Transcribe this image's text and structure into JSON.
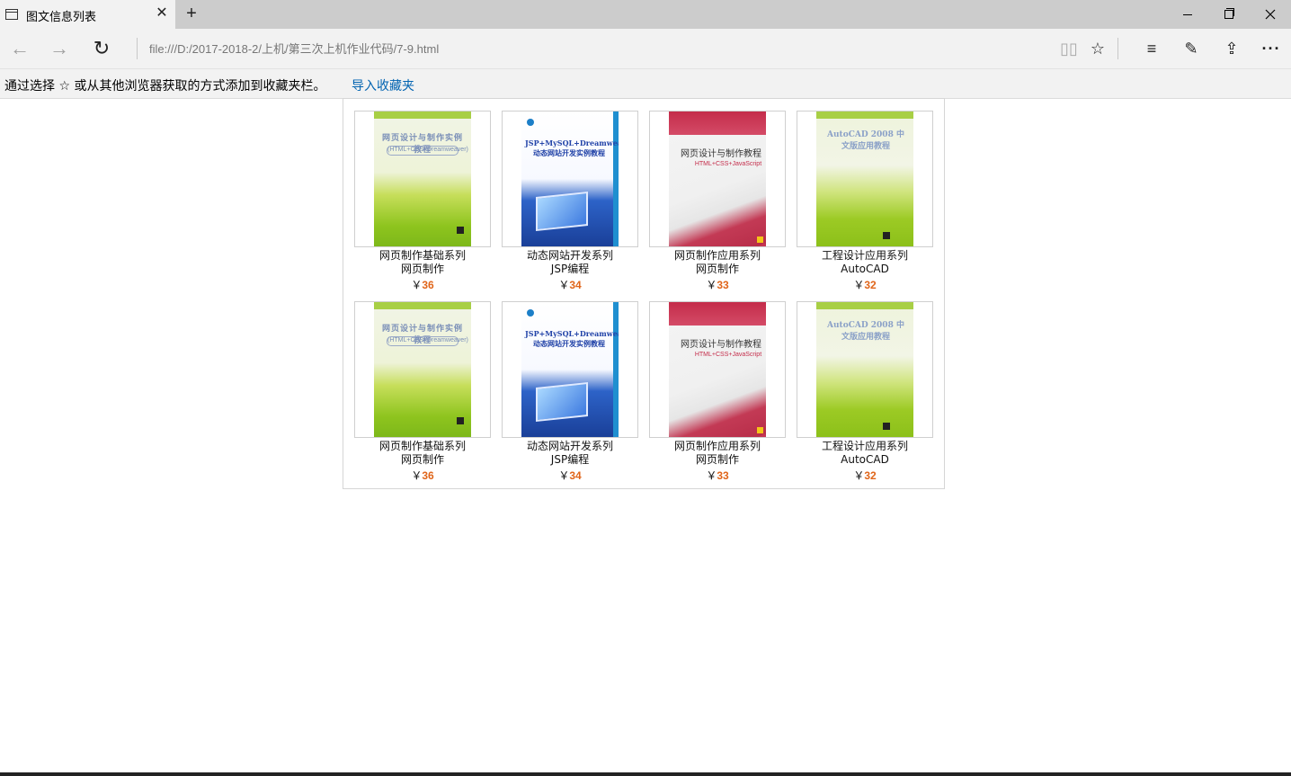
{
  "window": {
    "tab_title": "图文信息列表",
    "tab_close": "✕",
    "new_tab": "+"
  },
  "toolbar": {
    "back_icon": "←",
    "forward_icon": "→",
    "refresh_icon": "↻",
    "address": "file:///D:/2017-2018-2/上机/第三次上机作业代码/7-9.html",
    "reading_icon": "▯▯",
    "favorite_icon": "☆",
    "hub_icon": "≡",
    "note_icon": "✎",
    "share_icon": "⇪",
    "more_icon": "···"
  },
  "favorites_bar": {
    "message": "通过选择 ☆ 或从其他浏览器获取的方式添加到收藏夹栏。",
    "import_link": "导入收藏夹"
  },
  "products": [
    {
      "series": "网页制作基础系列",
      "name": "网页制作",
      "currency": "￥",
      "price": "36",
      "cover_title": "网页设计与制作实例教程",
      "cover_subtitle": "(HTML+CSS+Dreamweaver)",
      "cover_style": "green"
    },
    {
      "series": "动态网站开发系列",
      "name": "JSP编程",
      "currency": "￥",
      "price": "34",
      "cover_title": "JSP+MySQL+Dreamweaver动态网站开发实例教程",
      "cover_subtitle": "",
      "cover_style": "blue"
    },
    {
      "series": "网页制作应用系列",
      "name": "网页制作",
      "currency": "￥",
      "price": "33",
      "cover_title": "网页设计与制作教程",
      "cover_subtitle": "HTML+CSS+JavaScript",
      "cover_style": "red"
    },
    {
      "series": "工程设计应用系列",
      "name": "AutoCAD",
      "currency": "￥",
      "price": "32",
      "cover_title": "AutoCAD 2008 中文版应用教程",
      "cover_subtitle": "",
      "cover_style": "lime"
    },
    {
      "series": "网页制作基础系列",
      "name": "网页制作",
      "currency": "￥",
      "price": "36",
      "cover_title": "网页设计与制作实例教程",
      "cover_subtitle": "(HTML+CSS+Dreamweaver)",
      "cover_style": "green"
    },
    {
      "series": "动态网站开发系列",
      "name": "JSP编程",
      "currency": "￥",
      "price": "34",
      "cover_title": "JSP+MySQL+Dreamweaver动态网站开发实例教程",
      "cover_subtitle": "",
      "cover_style": "blue"
    },
    {
      "series": "网页制作应用系列",
      "name": "网页制作",
      "currency": "￥",
      "price": "33",
      "cover_title": "网页设计与制作教程",
      "cover_subtitle": "HTML+CSS+JavaScript",
      "cover_style": "red"
    },
    {
      "series": "工程设计应用系列",
      "name": "AutoCAD",
      "currency": "￥",
      "price": "32",
      "cover_title": "AutoCAD 2008 中文版应用教程",
      "cover_subtitle": "",
      "cover_style": "lime"
    }
  ]
}
